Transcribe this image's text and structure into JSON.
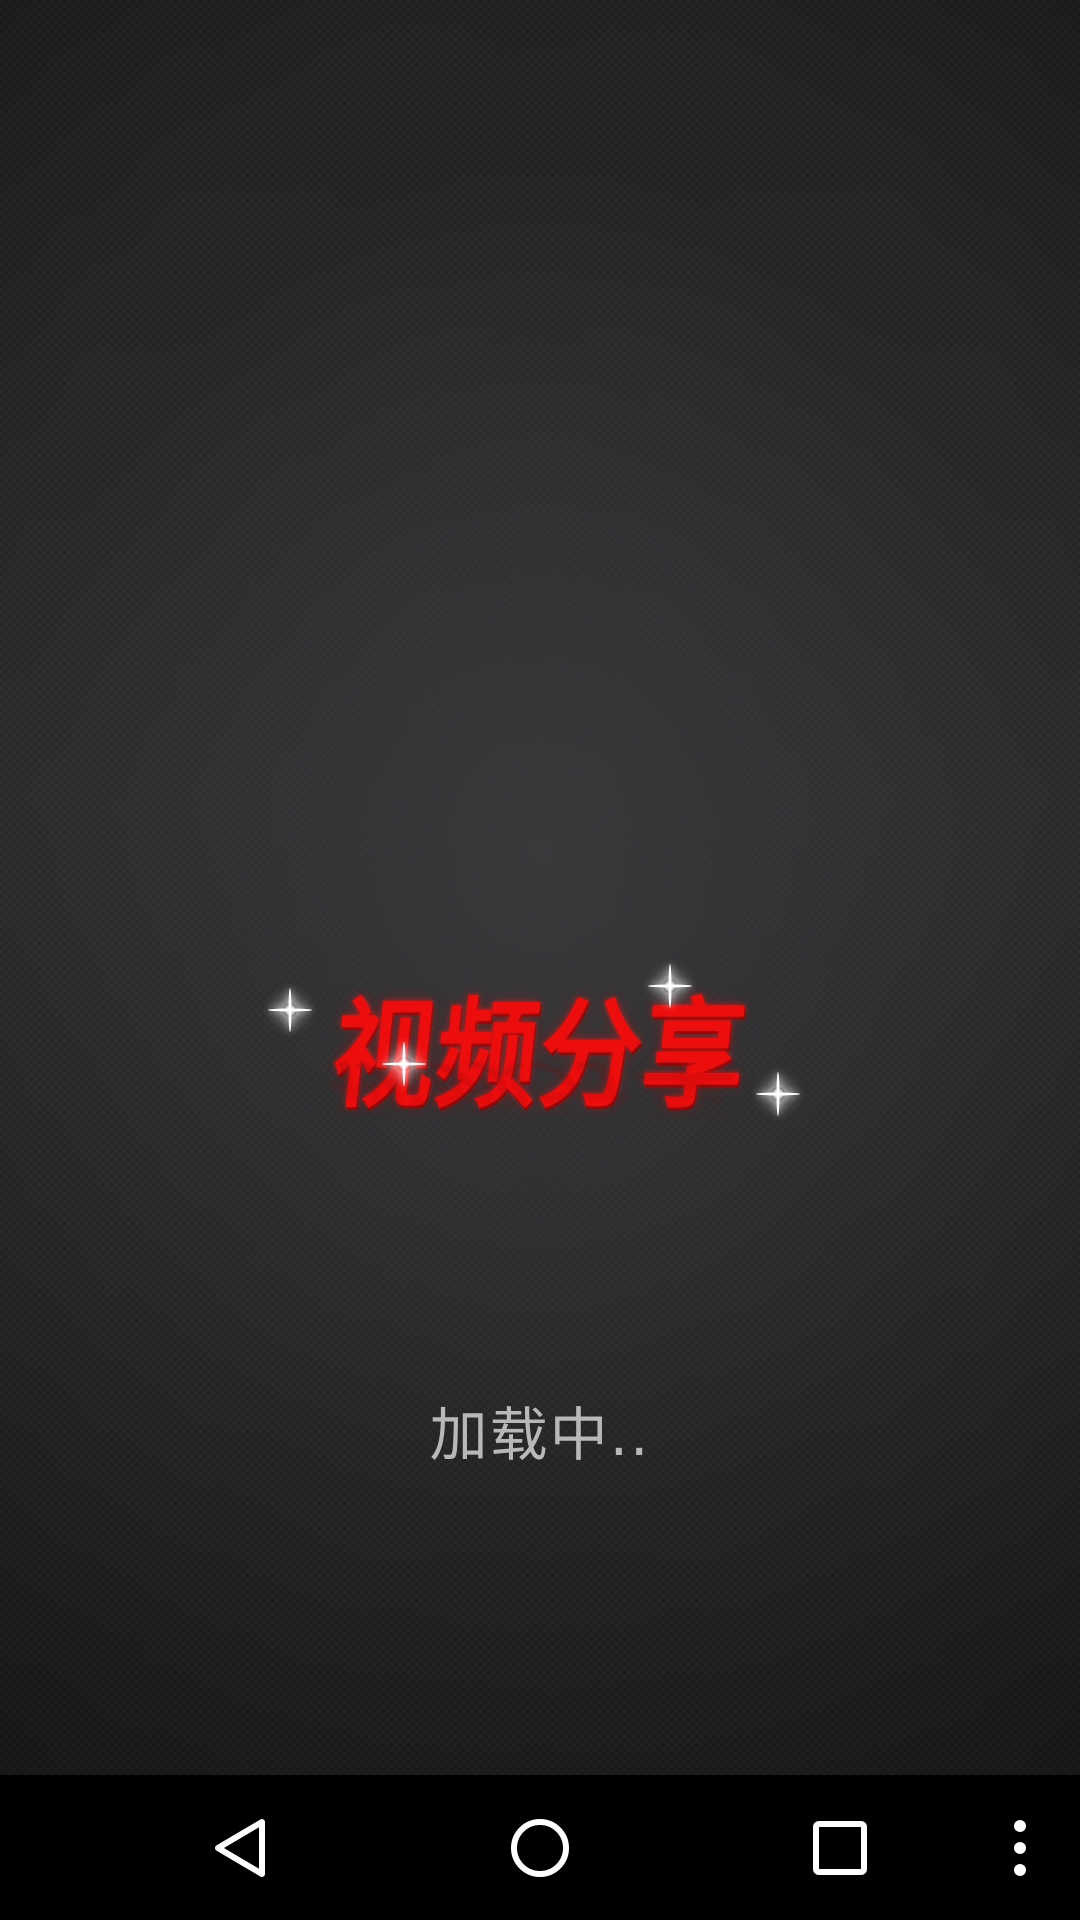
{
  "splash": {
    "logo_text": "视频分享",
    "loading_text": "加载中.."
  },
  "colors": {
    "logo_red": "#ee0d0d",
    "background": "#262627",
    "loading_text": "#b8b8b8",
    "navbar": "#000000",
    "nav_icon": "#ffffff"
  },
  "navbar": {
    "buttons": [
      {
        "icon": "back-triangle-icon"
      },
      {
        "icon": "home-circle-icon"
      },
      {
        "icon": "recent-apps-square-icon"
      },
      {
        "icon": "overflow-menu-icon"
      }
    ]
  }
}
